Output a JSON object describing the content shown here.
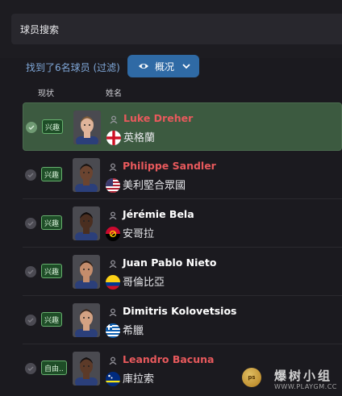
{
  "search": {
    "label": "球员搜索"
  },
  "results": {
    "found_text": "找到了6名球员 (过滤)",
    "view_button": "概况"
  },
  "columns": {
    "status": "现状",
    "name": "姓名"
  },
  "players": [
    {
      "name": "Luke Dreher",
      "nation": "英格蘭",
      "flag": "england",
      "tag": "兴趣",
      "name_color": "red",
      "selected": true
    },
    {
      "name": "Philippe Sandler",
      "nation": "美利堅合眾國",
      "flag": "usa",
      "tag": "兴趣",
      "name_color": "red",
      "selected": false
    },
    {
      "name": "Jérémie Bela",
      "nation": "安哥拉",
      "flag": "angola",
      "tag": "兴趣",
      "name_color": "white",
      "selected": false
    },
    {
      "name": "Juan Pablo Nieto",
      "nation": "哥倫比亞",
      "flag": "colombia",
      "tag": "兴趣",
      "name_color": "white",
      "selected": false
    },
    {
      "name": "Dimitris Kolovetsios",
      "nation": "希臘",
      "flag": "greece",
      "tag": "兴趣",
      "name_color": "white",
      "selected": false
    },
    {
      "name": "Leandro Bacuna",
      "nation": "庫拉索",
      "flag": "curacao",
      "tag": "自由..",
      "name_color": "red",
      "selected": false
    }
  ],
  "watermark": {
    "text": "爆树小组",
    "url": "WWW.PLAYGM.CC",
    "logo": "ps"
  },
  "colors": {
    "accent": "#2f6aa5",
    "selected_row": "#3c5a40",
    "tag_border": "#67b06e",
    "highlight_name": "#e8595c"
  },
  "icons": {
    "view": "eye-icon",
    "dropdown": "chevron-down-icon",
    "check": "check-icon",
    "person": "person-icon"
  }
}
